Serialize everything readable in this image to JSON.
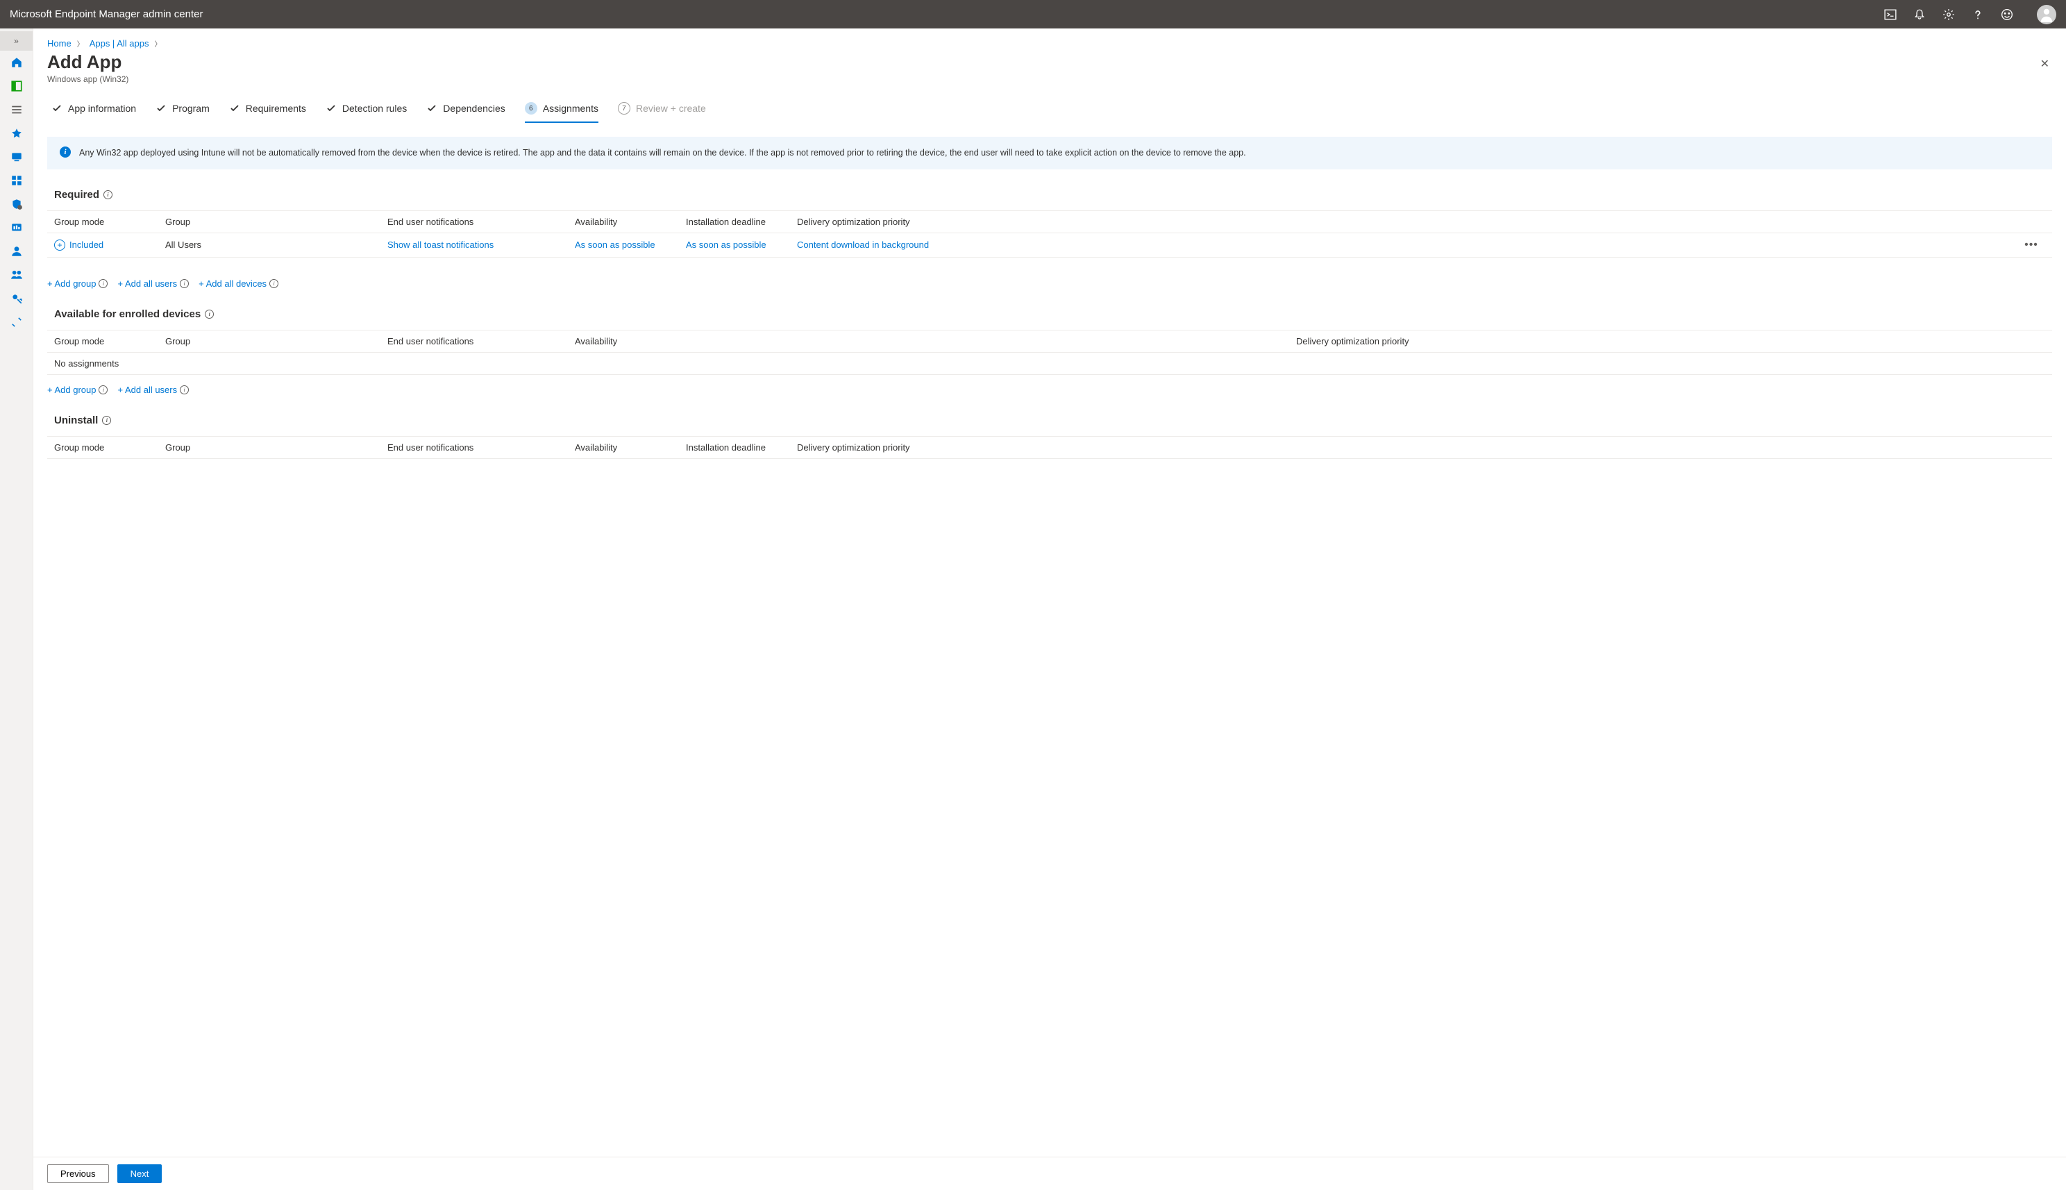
{
  "topbar": {
    "title": "Microsoft Endpoint Manager admin center"
  },
  "breadcrumb": {
    "home": "Home",
    "apps": "Apps | All apps"
  },
  "page": {
    "title": "Add App",
    "subtitle": "Windows app (Win32)"
  },
  "wizard": {
    "step1": "App information",
    "step2": "Program",
    "step3": "Requirements",
    "step4": "Detection rules",
    "step5": "Dependencies",
    "step6_num": "6",
    "step6": "Assignments",
    "step7_num": "7",
    "step7": "Review + create"
  },
  "infobox": "Any Win32 app deployed using Intune will not be automatically removed from the device when the device is retired. The app and the data it contains will remain on the device. If the app is not removed prior to retiring the device, the end user will need to take explicit action on the device to remove the app.",
  "sections": {
    "required": {
      "title": "Required",
      "headers": {
        "mode": "Group mode",
        "group": "Group",
        "notif": "End user notifications",
        "avail": "Availability",
        "deadline": "Installation deadline",
        "priority": "Delivery optimization priority"
      },
      "row": {
        "mode": "Included",
        "group": "All Users",
        "notif": "Show all toast notifications",
        "avail": "As soon as possible",
        "deadline": "As soon as possible",
        "priority": "Content download in background"
      },
      "actions": {
        "add_group": "+ Add group",
        "add_users": "+ Add all users",
        "add_devices": "+ Add all devices"
      }
    },
    "available": {
      "title": "Available for enrolled devices",
      "headers": {
        "mode": "Group mode",
        "group": "Group",
        "notif": "End user notifications",
        "avail": "Availability",
        "priority": "Delivery optimization priority"
      },
      "empty": "No assignments",
      "actions": {
        "add_group": "+ Add group",
        "add_users": "+ Add all users"
      }
    },
    "uninstall": {
      "title": "Uninstall",
      "headers": {
        "mode": "Group mode",
        "group": "Group",
        "notif": "End user notifications",
        "avail": "Availability",
        "deadline": "Installation deadline",
        "priority": "Delivery optimization priority"
      }
    }
  },
  "footer": {
    "prev": "Previous",
    "next": "Next"
  }
}
